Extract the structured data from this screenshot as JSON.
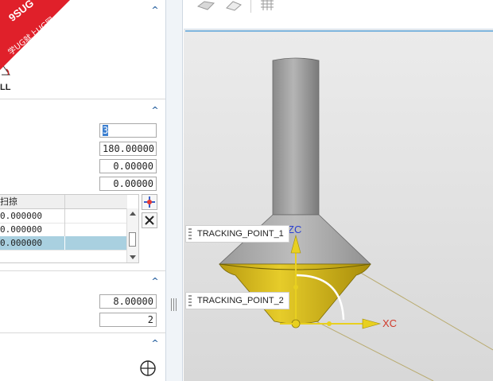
{
  "watermark": {
    "line1": "9SUG",
    "line2": "学UG就上UG网"
  },
  "dialog": {
    "icon_caption": "LL",
    "sections": [
      {
        "name": "section-1",
        "collapse_glyph": "^"
      },
      {
        "name": "section-2",
        "collapse_glyph": "^"
      },
      {
        "name": "section-3",
        "collapse_glyph": "^"
      },
      {
        "name": "section-4",
        "collapse_glyph": "^"
      }
    ],
    "fields_top": [
      "3",
      "180.00000",
      "0.00000",
      "0.00000"
    ],
    "table": {
      "header": "扫掠",
      "rows": [
        {
          "value": "0.000000",
          "selected": false
        },
        {
          "value": "0.000000",
          "selected": false
        },
        {
          "value": "0.000000",
          "selected": true
        }
      ],
      "add_icon": "add-point-icon",
      "delete_icon": "delete-x-icon"
    },
    "fields_mid": [
      "8.00000",
      "2"
    ],
    "bottom_icon": "crosshair-circle-icon"
  },
  "viewport": {
    "tracking_points": [
      "TRACKING_POINT_1",
      "TRACKING_POINT_2"
    ],
    "axes": {
      "z": "ZC",
      "x": "XC"
    },
    "colors": {
      "axis_z": "#2a3fd0",
      "axis_x": "#d03a2a",
      "handle": "#e8d020",
      "cone_highlight": "#e2c826",
      "shaft": "#8c8c8c"
    }
  }
}
